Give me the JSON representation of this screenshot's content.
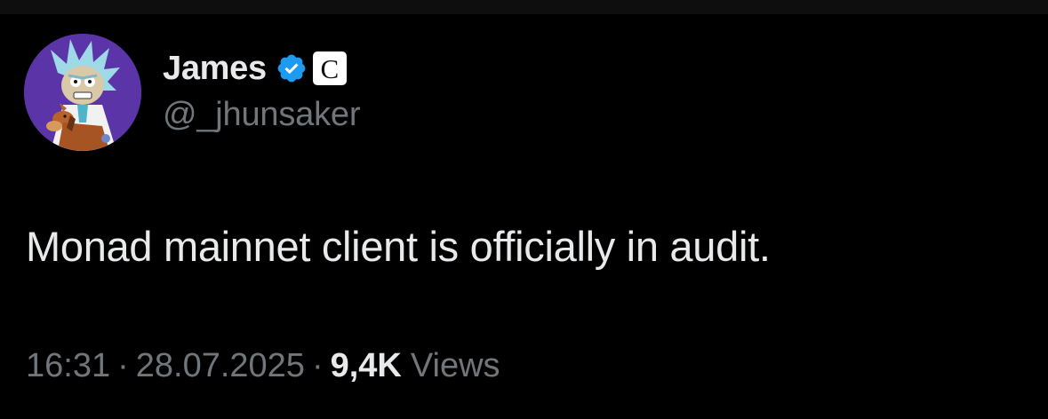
{
  "tweet": {
    "author": {
      "display_name": "James",
      "handle": "@_jhunsaker",
      "verified": true,
      "affiliate_badge_letter": "C"
    },
    "text": "Monad mainnet client is officially in audit.",
    "meta": {
      "time": "16:31",
      "separator": "·",
      "date": "28.07.2025",
      "views_count": "9,4K",
      "views_label": "Views"
    }
  },
  "colors": {
    "background": "#000000",
    "primary_text": "#e7e9ea",
    "secondary_text": "#71767b",
    "verified_blue": "#1d9bf0",
    "avatar_bg": "#5b35a8"
  },
  "icons": {
    "verified": "verified-badge-icon",
    "affiliate": "affiliate-badge-icon"
  }
}
